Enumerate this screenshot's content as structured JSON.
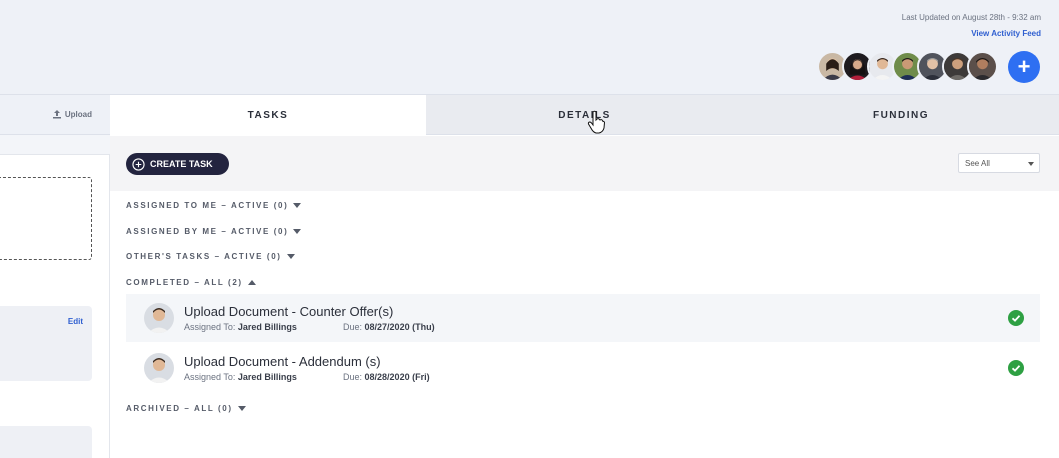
{
  "header": {
    "last_updated": "Last Updated on August 28th - 9:32 am",
    "activity_link": "View Activity Feed",
    "add_label": "+"
  },
  "left_panel": {
    "upload_label": "Upload",
    "edit_label": "Edit"
  },
  "tabs": [
    {
      "label": "TASKS",
      "active": true
    },
    {
      "label": "DETAILS",
      "active": false
    },
    {
      "label": "FUNDING",
      "active": false
    }
  ],
  "toolbar": {
    "create_task_label": "CREATE TASK",
    "filter_value": "See All"
  },
  "sections": {
    "assigned_to_me": "ASSIGNED TO ME – ACTIVE (0)",
    "assigned_by_me": "ASSIGNED BY ME – ACTIVE (0)",
    "others_tasks": "OTHER'S TASKS – ACTIVE (0)",
    "completed": "COMPLETED – ALL (2)",
    "archived": "ARCHIVED – ALL (0)"
  },
  "tasks": [
    {
      "title": "Upload Document - Counter Offer(s)",
      "assigned_prefix": "Assigned To:",
      "assignee": "Jared Billings",
      "due_prefix": "Due:",
      "due_date": "08/27/2020",
      "due_day": "(Thu)",
      "status": "completed"
    },
    {
      "title": "Upload Document - Addendum (s)",
      "assigned_prefix": "Assigned To:",
      "assignee": "Jared Billings",
      "due_prefix": "Due:",
      "due_date": "08/28/2020",
      "due_day": "(Fri)",
      "status": "completed"
    }
  ],
  "colors": {
    "accent_blue": "#2e6ff2",
    "link_blue": "#2f5fd0",
    "create_button": "#23243f",
    "success_green": "#2ea043"
  }
}
